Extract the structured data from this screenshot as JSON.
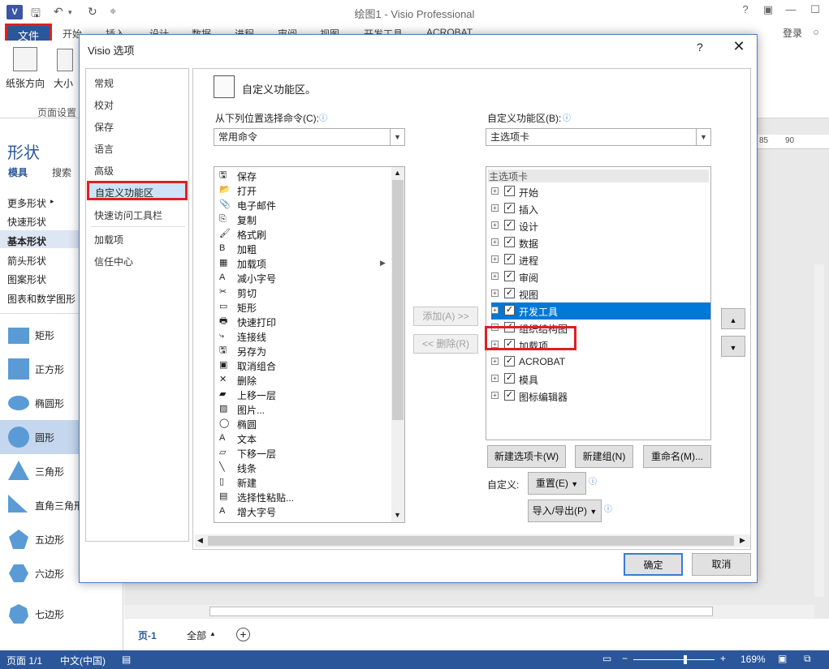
{
  "window": {
    "title": "绘图1 - Visio Professional",
    "logo": "V",
    "login": "登录",
    "help": "?"
  },
  "ribbon_tabs": {
    "file": "文件",
    "start": "开始",
    "insert": "插入",
    "design": "设计",
    "data": "数据",
    "process": "进程",
    "review": "审阅",
    "view": "视图",
    "developer": "开发工具",
    "acrobat": "ACROBAT"
  },
  "ribbon": {
    "orientation": "纸张方向",
    "size": "大小",
    "page_setup": "页面设置"
  },
  "shapes_panel": {
    "title": "形状",
    "tab_stencil": "模具",
    "tab_search": "搜索",
    "links": [
      "更多形状",
      "快速形状",
      "基本形状",
      "箭头形状",
      "图案形状",
      "图表和数学图形"
    ],
    "shapes": [
      "矩形",
      "正方形",
      "椭圆形",
      "圆形",
      "三角形",
      "直角三角形",
      "五边形",
      "六边形",
      "七边形"
    ]
  },
  "ruler": {
    "t85": "85",
    "t90": "90"
  },
  "page_tabs": {
    "page1": "页-1",
    "all": "全部"
  },
  "status": {
    "page": "页面 1/1",
    "lang": "中文(中国)",
    "zoom": "169%"
  },
  "dialog": {
    "title": "Visio 选项",
    "help": "?",
    "close": "✕",
    "nav": [
      "常规",
      "校对",
      "保存",
      "语言",
      "高级",
      "自定义功能区",
      "快速访问工具栏",
      "加载项",
      "信任中心"
    ],
    "heading": "自定义功能区。",
    "left_label": "从下列位置选择命令(C):",
    "left_combo": "常用命令",
    "right_label": "自定义功能区(B):",
    "right_combo": "主选项卡",
    "commands": [
      "保存",
      "打开",
      "电子邮件",
      "复制",
      "格式刷",
      "加粗",
      "加载项",
      "减小字号",
      "剪切",
      "矩形",
      "快速打印",
      "连接线",
      "另存为",
      "取消组合",
      "删除",
      "上移一层",
      "图片...",
      "椭圆",
      "文本",
      "下移一层",
      "线条",
      "新建",
      "选择性粘贴...",
      "增大字号"
    ],
    "tree_header": "主选项卡",
    "tree": [
      "开始",
      "插入",
      "设计",
      "数据",
      "进程",
      "审阅",
      "视图",
      "开发工具",
      "组织结构图",
      "加载项",
      "ACROBAT",
      "模具",
      "图标编辑器"
    ],
    "add_btn": "添加(A) >>",
    "remove_btn": "<< 删除(R)",
    "new_tab": "新建选项卡(W)",
    "new_group": "新建组(N)",
    "rename": "重命名(M)...",
    "customize_label": "自定义:",
    "reset": "重置(E)",
    "import_export": "导入/导出(P)",
    "ok": "确定",
    "cancel": "取消"
  }
}
